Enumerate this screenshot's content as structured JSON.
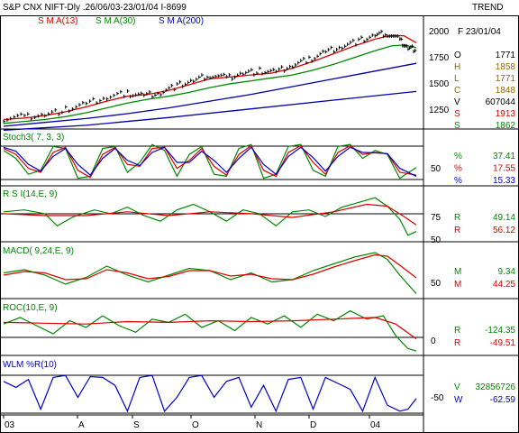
{
  "header": {
    "title": "S&P CNX NIFT-Dly .26/06/03-23/01/04 I-8699",
    "trend": "TREND",
    "sma13": "S M A(13)",
    "sma30": "S M A(30)",
    "sma200": "S M A(200)"
  },
  "colors": {
    "price": "#000000",
    "sma13": "#dd0000",
    "sma30": "#008800",
    "sma200": "#0000aa",
    "stoch_pct": "#0000cc",
    "wlm": "#0000cc",
    "frame": "#000000"
  },
  "side": {
    "date": "F 23/01/04",
    "price_rows": [
      {
        "k": "O",
        "v": "1771",
        "color": "#000000"
      },
      {
        "k": "H",
        "v": "1858",
        "color": "#996600"
      },
      {
        "k": "L",
        "v": "1771",
        "color": "#996600"
      },
      {
        "k": "C",
        "v": "1848",
        "color": "#996600"
      },
      {
        "k": "V",
        "v": "607044",
        "color": "#000000"
      },
      {
        "k": "S",
        "v": "1913",
        "color": "#dd0000"
      },
      {
        "k": "S",
        "v": "1862",
        "color": "#008800"
      }
    ],
    "stoch_rows": [
      {
        "k": "%",
        "v": "37.41",
        "color": "#008800"
      },
      {
        "k": "%",
        "v": "17.55",
        "color": "#dd0000"
      },
      {
        "k": "%",
        "v": "15.33",
        "color": "#0000cc"
      }
    ],
    "rsi_rows": [
      {
        "k": "R",
        "v": "49.14",
        "color": "#008800"
      },
      {
        "k": "R",
        "v": "56.12",
        "color": "#dd0000"
      }
    ],
    "macd_rows": [
      {
        "k": "M",
        "v": "9.34",
        "color": "#008800"
      },
      {
        "k": "M",
        "v": "44.25",
        "color": "#dd0000"
      }
    ],
    "roc_rows": [
      {
        "k": "R",
        "v": "-124.35",
        "color": "#008800"
      },
      {
        "k": "R",
        "v": "-49.51",
        "color": "#dd0000"
      }
    ],
    "wlm_rows": [
      {
        "k": "V",
        "v": "32856726",
        "color": "#008800"
      },
      {
        "k": "W",
        "v": "-62.59",
        "color": "#0000cc"
      }
    ]
  },
  "chart_data": [
    {
      "type": "line",
      "panel": "price",
      "x_label_ticks": [
        "03",
        "A",
        "S",
        "O",
        "N",
        "D",
        "04"
      ],
      "y_ticks": [
        "2000",
        "1750",
        "1500",
        "1250"
      ],
      "ylim": [
        1050,
        2075
      ],
      "series": [
        {
          "name": "S M A(13)",
          "x": [
            0,
            0.05,
            0.1,
            0.15,
            0.2,
            0.25,
            0.3,
            0.35,
            0.4,
            0.45,
            0.5,
            0.55,
            0.6,
            0.65,
            0.7,
            0.75,
            0.8,
            0.85,
            0.9,
            0.94,
            0.97,
            1.0
          ],
          "values": [
            1120,
            1135,
            1160,
            1200,
            1250,
            1310,
            1360,
            1380,
            1420,
            1480,
            1540,
            1560,
            1580,
            1600,
            1650,
            1720,
            1800,
            1880,
            1950,
            1990,
            1985,
            1913
          ]
        },
        {
          "name": "S M A(30)",
          "x": [
            0,
            0.05,
            0.1,
            0.15,
            0.2,
            0.25,
            0.3,
            0.35,
            0.4,
            0.45,
            0.5,
            0.55,
            0.6,
            0.65,
            0.7,
            0.75,
            0.8,
            0.85,
            0.9,
            0.94,
            0.97,
            1.0
          ],
          "values": [
            1080,
            1100,
            1120,
            1150,
            1190,
            1240,
            1290,
            1330,
            1360,
            1400,
            1450,
            1490,
            1520,
            1550,
            1580,
            1630,
            1690,
            1760,
            1830,
            1880,
            1890,
            1862
          ]
        },
        {
          "name": "S M A(200)",
          "x": [
            0,
            0.1,
            0.2,
            0.3,
            0.4,
            0.5,
            0.6,
            0.7,
            0.8,
            0.9,
            1.0
          ],
          "values": [
            1050,
            1090,
            1130,
            1180,
            1240,
            1310,
            1380,
            1460,
            1540,
            1620,
            1700
          ]
        },
        {
          "name": "Lower trendline",
          "x": [
            0,
            0.2,
            0.4,
            0.6,
            0.8,
            1.0
          ],
          "values": [
            1010,
            1060,
            1140,
            1230,
            1320,
            1410
          ]
        }
      ],
      "price_path": {
        "x": [
          0,
          0.05,
          0.1,
          0.15,
          0.2,
          0.25,
          0.3,
          0.34,
          0.38,
          0.42,
          0.46,
          0.5,
          0.54,
          0.58,
          0.62,
          0.66,
          0.7,
          0.74,
          0.78,
          0.82,
          0.86,
          0.9,
          0.93,
          0.96,
          0.98,
          1.0
        ],
        "values": [
          1130,
          1150,
          1170,
          1220,
          1280,
          1350,
          1390,
          1370,
          1400,
          1470,
          1520,
          1580,
          1550,
          1600,
          1620,
          1610,
          1680,
          1740,
          1820,
          1880,
          1930,
          1990,
          2010,
          1940,
          1860,
          1848
        ]
      }
    },
    {
      "type": "line",
      "panel": "stoch",
      "title": "Stoch3( 7, 3, 3)",
      "y_ticks": [
        "50"
      ],
      "ylim": [
        0,
        100
      ],
      "series": [
        {
          "name": "%",
          "x": [
            0,
            0.03,
            0.06,
            0.09,
            0.12,
            0.15,
            0.18,
            0.21,
            0.24,
            0.27,
            0.3,
            0.33,
            0.36,
            0.39,
            0.42,
            0.45,
            0.48,
            0.51,
            0.54,
            0.57,
            0.6,
            0.63,
            0.66,
            0.69,
            0.72,
            0.75,
            0.78,
            0.81,
            0.84,
            0.87,
            0.9,
            0.93,
            0.96,
            1.0
          ],
          "values": [
            80,
            60,
            20,
            30,
            90,
            85,
            10,
            15,
            85,
            90,
            25,
            50,
            95,
            80,
            15,
            70,
            90,
            20,
            15,
            85,
            95,
            10,
            20,
            90,
            95,
            30,
            15,
            90,
            95,
            60,
            80,
            70,
            10,
            37
          ]
        },
        {
          "name": "%",
          "x": [
            0,
            0.03,
            0.06,
            0.09,
            0.12,
            0.15,
            0.18,
            0.21,
            0.24,
            0.27,
            0.3,
            0.33,
            0.36,
            0.39,
            0.42,
            0.45,
            0.48,
            0.51,
            0.54,
            0.57,
            0.6,
            0.63,
            0.66,
            0.69,
            0.72,
            0.75,
            0.78,
            0.81,
            0.84,
            0.87,
            0.9,
            0.93,
            0.96,
            1.0
          ],
          "values": [
            85,
            70,
            35,
            25,
            75,
            88,
            30,
            12,
            70,
            88,
            45,
            40,
            85,
            88,
            35,
            55,
            85,
            40,
            18,
            70,
            92,
            30,
            15,
            75,
            92,
            50,
            20,
            75,
            92,
            70,
            75,
            72,
            25,
            18
          ]
        },
        {
          "name": "%",
          "x": [
            0,
            0.03,
            0.06,
            0.09,
            0.12,
            0.15,
            0.18,
            0.21,
            0.24,
            0.27,
            0.3,
            0.33,
            0.36,
            0.39,
            0.42,
            0.45,
            0.48,
            0.51,
            0.54,
            0.57,
            0.6,
            0.63,
            0.66,
            0.69,
            0.72,
            0.75,
            0.78,
            0.81,
            0.84,
            0.87,
            0.9,
            0.93,
            0.96,
            1.0
          ],
          "values": [
            88,
            78,
            45,
            28,
            65,
            85,
            45,
            18,
            60,
            85,
            55,
            42,
            75,
            88,
            50,
            50,
            78,
            55,
            25,
            60,
            88,
            45,
            20,
            65,
            88,
            62,
            28,
            65,
            88,
            75,
            74,
            72,
            35,
            15
          ]
        }
      ]
    },
    {
      "type": "line",
      "panel": "rsi",
      "title": "R S I(14,E, 9)",
      "y_ticks": [
        "75",
        "50"
      ],
      "ylim": [
        40,
        90
      ],
      "series": [
        {
          "name": "R",
          "x": [
            0,
            0.05,
            0.1,
            0.13,
            0.17,
            0.22,
            0.26,
            0.3,
            0.34,
            0.38,
            0.42,
            0.46,
            0.5,
            0.54,
            0.58,
            0.62,
            0.66,
            0.7,
            0.74,
            0.78,
            0.82,
            0.86,
            0.9,
            0.93,
            0.96,
            0.98,
            1.0
          ],
          "values": [
            70,
            72,
            68,
            55,
            65,
            72,
            68,
            75,
            66,
            60,
            72,
            78,
            70,
            60,
            72,
            68,
            55,
            70,
            72,
            65,
            75,
            80,
            85,
            76,
            62,
            45,
            49
          ]
        },
        {
          "name": "R",
          "x": [
            0,
            0.1,
            0.2,
            0.3,
            0.4,
            0.5,
            0.6,
            0.7,
            0.8,
            0.88,
            0.93,
            0.97,
            1.0
          ],
          "values": [
            68,
            66,
            66,
            70,
            66,
            70,
            68,
            64,
            70,
            78,
            76,
            65,
            56
          ]
        }
      ]
    },
    {
      "type": "line",
      "panel": "macd",
      "title": "MACD( 9,24,E, 9)",
      "y_ticks": [
        "50"
      ],
      "ylim": [
        0,
        110
      ],
      "series": [
        {
          "name": "M",
          "x": [
            0,
            0.05,
            0.1,
            0.15,
            0.2,
            0.25,
            0.3,
            0.35,
            0.4,
            0.45,
            0.5,
            0.55,
            0.6,
            0.65,
            0.7,
            0.75,
            0.8,
            0.85,
            0.9,
            0.93,
            0.96,
            1.0
          ],
          "values": [
            55,
            62,
            50,
            30,
            45,
            70,
            50,
            35,
            50,
            65,
            60,
            40,
            55,
            35,
            40,
            60,
            75,
            90,
            100,
            85,
            50,
            9
          ]
        },
        {
          "name": "M",
          "x": [
            0,
            0.05,
            0.1,
            0.15,
            0.2,
            0.25,
            0.3,
            0.35,
            0.4,
            0.45,
            0.5,
            0.55,
            0.6,
            0.65,
            0.7,
            0.75,
            0.8,
            0.85,
            0.9,
            0.93,
            0.96,
            1.0
          ],
          "values": [
            50,
            58,
            55,
            40,
            42,
            62,
            55,
            42,
            47,
            60,
            60,
            48,
            52,
            42,
            40,
            52,
            68,
            82,
            95,
            92,
            72,
            44
          ]
        }
      ]
    },
    {
      "type": "line",
      "panel": "roc",
      "title": "ROC(10,E, 9)",
      "y_ticks": [
        "0"
      ],
      "ylim": [
        -140,
        140
      ],
      "series": [
        {
          "name": "R",
          "x": [
            0,
            0.04,
            0.08,
            0.12,
            0.16,
            0.2,
            0.24,
            0.28,
            0.32,
            0.36,
            0.4,
            0.44,
            0.48,
            0.52,
            0.56,
            0.6,
            0.64,
            0.68,
            0.72,
            0.76,
            0.8,
            0.84,
            0.88,
            0.92,
            0.95,
            0.98,
            1.0
          ],
          "values": [
            40,
            80,
            30,
            -20,
            60,
            20,
            90,
            30,
            -10,
            70,
            50,
            100,
            20,
            60,
            0,
            80,
            40,
            90,
            20,
            100,
            60,
            120,
            70,
            90,
            -30,
            -110,
            -124
          ]
        },
        {
          "name": "R",
          "x": [
            0,
            0.1,
            0.2,
            0.3,
            0.4,
            0.5,
            0.6,
            0.7,
            0.8,
            0.9,
            0.95,
            1.0
          ],
          "values": [
            50,
            45,
            40,
            55,
            50,
            60,
            55,
            60,
            70,
            80,
            40,
            -50
          ]
        }
      ]
    },
    {
      "type": "line",
      "panel": "wlm",
      "title": "WLM %R(10)",
      "y_ticks": [
        "-50"
      ],
      "ylim": [
        -100,
        0
      ],
      "series": [
        {
          "name": "W",
          "x": [
            0,
            0.03,
            0.06,
            0.09,
            0.12,
            0.15,
            0.18,
            0.21,
            0.24,
            0.27,
            0.3,
            0.33,
            0.36,
            0.39,
            0.42,
            0.45,
            0.48,
            0.51,
            0.54,
            0.57,
            0.6,
            0.63,
            0.66,
            0.69,
            0.72,
            0.75,
            0.78,
            0.81,
            0.84,
            0.87,
            0.9,
            0.93,
            0.96,
            0.98,
            1.0
          ],
          "values": [
            -20,
            -35,
            -15,
            -90,
            -10,
            -5,
            -60,
            -8,
            -10,
            -30,
            -95,
            -10,
            -5,
            -95,
            -60,
            -10,
            -5,
            -60,
            -20,
            -10,
            -85,
            -30,
            -95,
            -15,
            -10,
            -90,
            -10,
            -25,
            -40,
            -95,
            -10,
            -80,
            -95,
            -90,
            -63
          ]
        }
      ]
    }
  ]
}
